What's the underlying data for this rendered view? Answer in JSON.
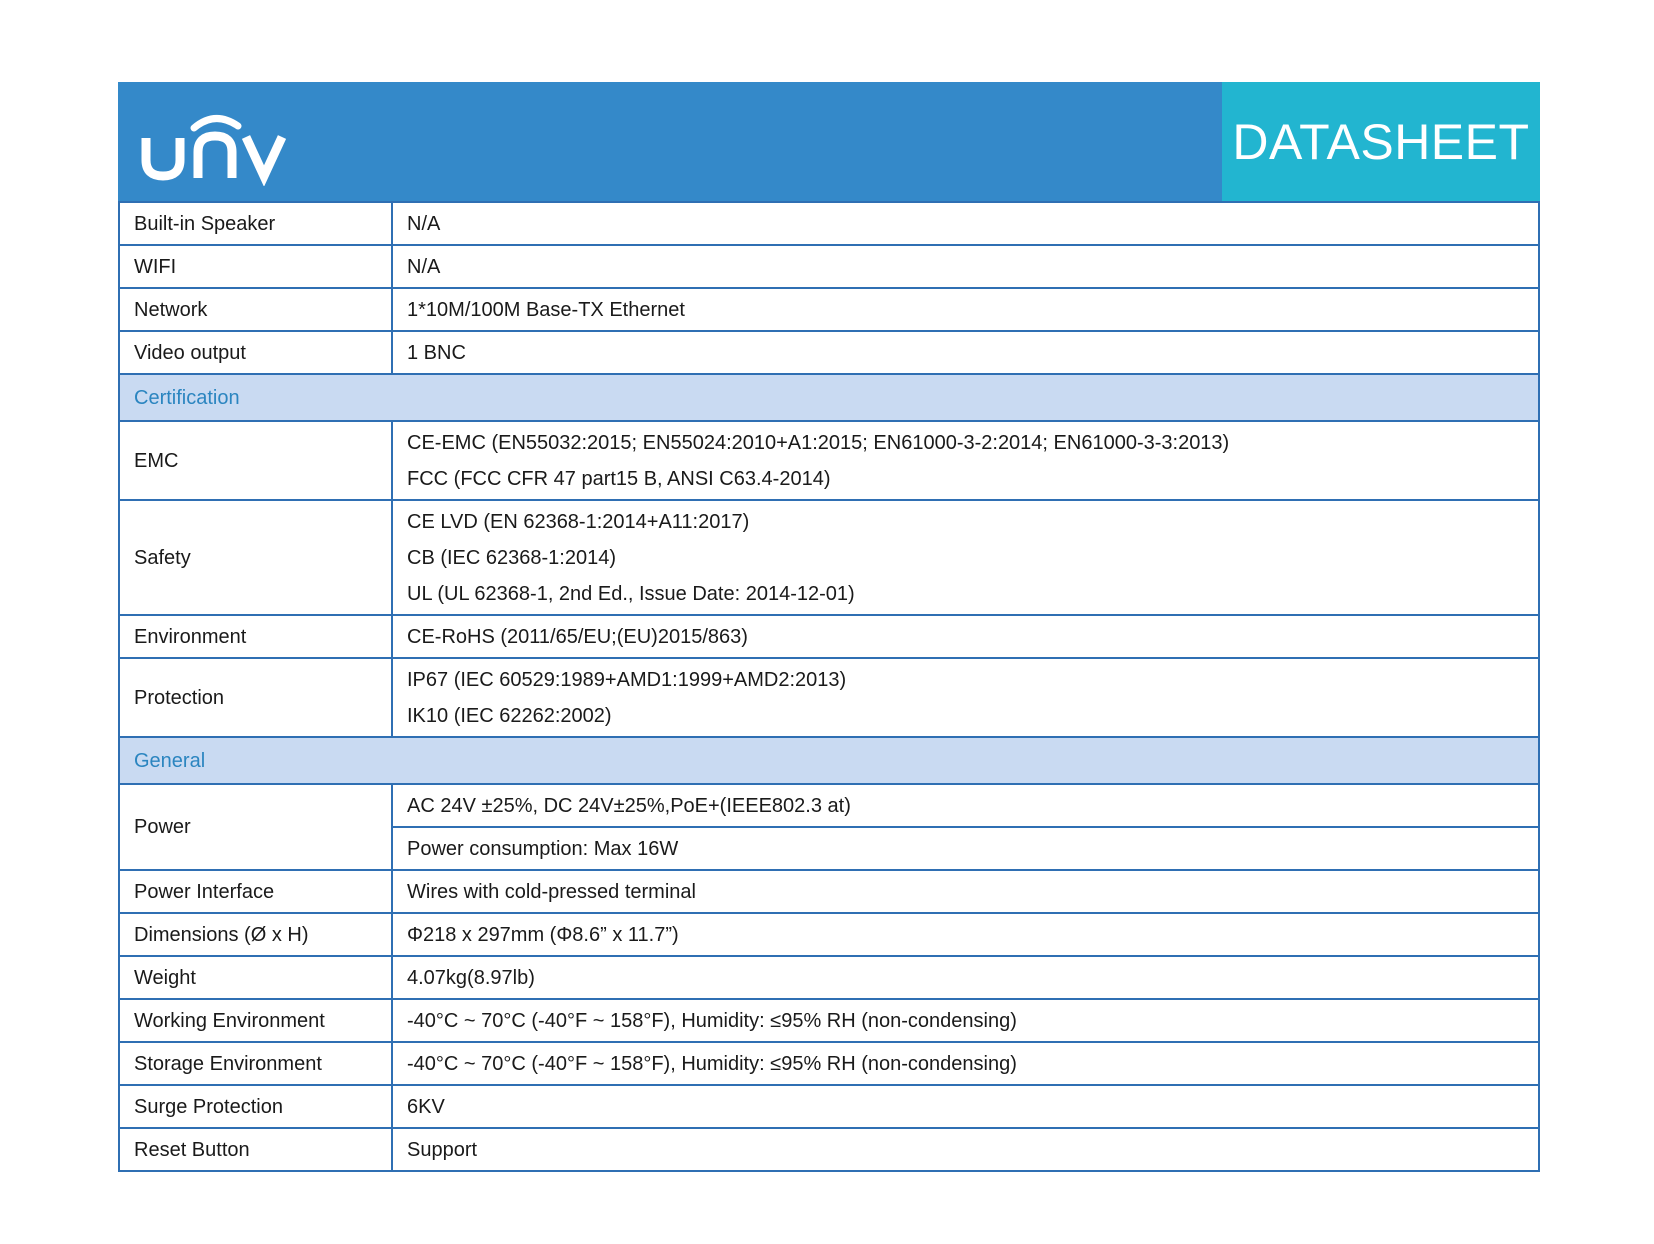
{
  "header": {
    "logo_text": "unv",
    "tag": "DATASHEET"
  },
  "colors": {
    "header_blue": "#3489c9",
    "tag_cyan": "#22b5d0",
    "border": "#2f6fb3",
    "section_bg": "#c9daf2",
    "section_text": "#2b85c0"
  },
  "rows": {
    "speaker": {
      "label": "Built-in Speaker",
      "value": "N/A"
    },
    "wifi": {
      "label": "WIFI",
      "value": "N/A"
    },
    "network": {
      "label": "Network",
      "value": "1*10M/100M Base-TX Ethernet"
    },
    "video_output": {
      "label": "Video output",
      "value": "1 BNC"
    }
  },
  "certification": {
    "title": "Certification",
    "emc": {
      "label": "EMC",
      "lines": [
        "CE-EMC (EN55032:2015; EN55024:2010+A1:2015; EN61000-3-2:2014; EN61000-3-3:2013)",
        "FCC (FCC CFR 47 part15 B, ANSI C63.4-2014)"
      ]
    },
    "safety": {
      "label": "Safety",
      "lines": [
        "CE LVD (EN 62368-1:2014+A11:2017)",
        "CB (IEC 62368-1:2014)",
        "UL (UL 62368-1, 2nd Ed., Issue Date: 2014-12-01)"
      ]
    },
    "environment": {
      "label": "Environment",
      "value": "CE-RoHS (2011/65/EU;(EU)2015/863)"
    },
    "protection": {
      "label": "Protection",
      "lines": [
        "IP67 (IEC 60529:1989+AMD1:1999+AMD2:2013)",
        "IK10 (IEC 62262:2002)"
      ]
    }
  },
  "general": {
    "title": "General",
    "power": {
      "label": "Power",
      "lines": [
        "AC 24V ±25%, DC 24V±25%,PoE+(IEEE802.3 at)",
        "Power consumption: Max 16W"
      ]
    },
    "power_interface": {
      "label": "Power Interface",
      "value": "Wires with cold-pressed terminal"
    },
    "dimensions": {
      "label": "Dimensions (Ø x H)",
      "value": "Φ218 x 297mm (Φ8.6” x 11.7”)"
    },
    "weight": {
      "label": "Weight",
      "value": "4.07kg(8.97lb)"
    },
    "working_env": {
      "label": "Working Environment",
      "value": "-40°C ~ 70°C (-40°F ~ 158°F), Humidity: ≤95% RH (non-condensing)"
    },
    "storage_env": {
      "label": "Storage Environment",
      "value": "-40°C ~ 70°C (-40°F ~ 158°F), Humidity: ≤95% RH (non-condensing)"
    },
    "surge": {
      "label": "Surge Protection",
      "value": "6KV"
    },
    "reset": {
      "label": "Reset Button",
      "value": "Support"
    }
  }
}
